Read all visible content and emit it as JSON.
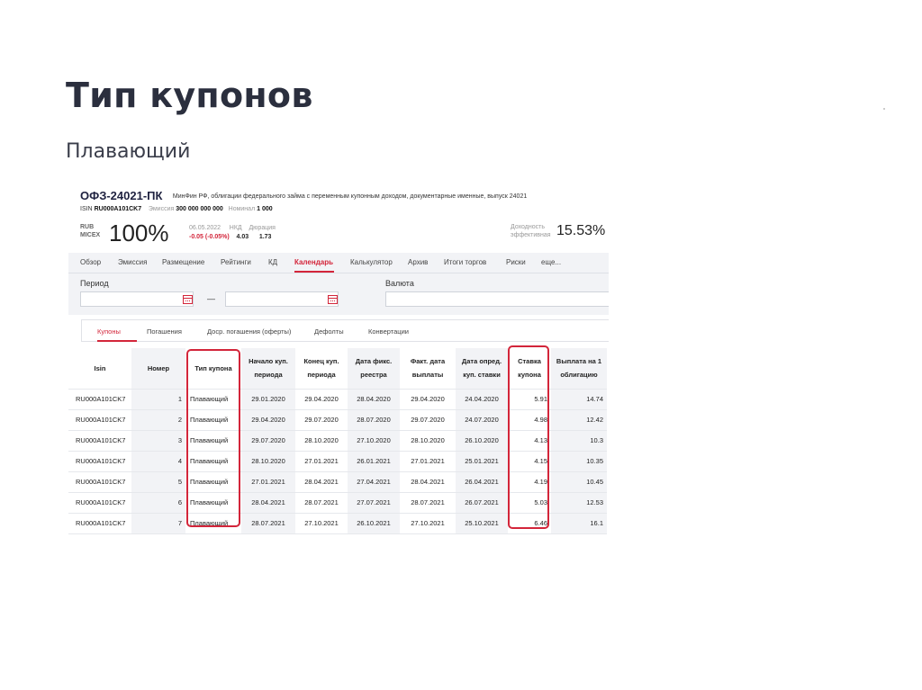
{
  "slide": {
    "title": "Тип купонов",
    "subtitle": "Плавающий"
  },
  "bond": {
    "name": "ОФЗ-24021-ПК",
    "description": "МинФин РФ, облигации федерального займа с переменным купонным доходом, документарные именные, выпуск 24021",
    "isin_label": "ISIN",
    "isin": "RU000A101CK7",
    "emission_label": "Эмиссия",
    "emission": "300 000 000 000",
    "nominal_label": "Номинал",
    "nominal": "1 000"
  },
  "quote": {
    "currency": "RUB",
    "exchange": "MICEX",
    "price": "100%",
    "date": "06.05.2022",
    "change": "-0.05 (-0.05%)",
    "nkd_label": "НКД",
    "nkd": "4.03",
    "duration_label": "Дюрация",
    "duration": "1.73",
    "yield_label_1": "Доходность",
    "yield_label_2": "эффективная",
    "yield": "15.53%"
  },
  "tabs": [
    "Обзор",
    "Эмиссия",
    "Размещение",
    "Рейтинги",
    "КД",
    "Календарь",
    "Калькулятор",
    "Архив",
    "Итоги торгов",
    "Риски",
    "еще..."
  ],
  "active_tab": "Календарь",
  "filters": {
    "period_label": "Период",
    "currency_label": "Валюта",
    "dash": "—"
  },
  "subtabs": [
    "Купоны",
    "Погашения",
    "Доср. погашения (оферты)",
    "Дефолты",
    "Конвертации"
  ],
  "active_subtab": "Купоны",
  "table": {
    "headers": [
      "Isin",
      "Номер",
      "Тип купона",
      "Начало куп. периода",
      "Конец куп. периода",
      "Дата фикс. реестра",
      "Факт. дата выплаты",
      "Дата опред. куп. ставки",
      "Ставка купона",
      "Выплата на 1 облигацию"
    ],
    "rows": [
      [
        "RU000A101CK7",
        "1",
        "Плавающий",
        "29.01.2020",
        "29.04.2020",
        "28.04.2020",
        "29.04.2020",
        "24.04.2020",
        "5.91",
        "14.74"
      ],
      [
        "RU000A101CK7",
        "2",
        "Плавающий",
        "29.04.2020",
        "29.07.2020",
        "28.07.2020",
        "29.07.2020",
        "24.07.2020",
        "4.98",
        "12.42"
      ],
      [
        "RU000A101CK7",
        "3",
        "Плавающий",
        "29.07.2020",
        "28.10.2020",
        "27.10.2020",
        "28.10.2020",
        "26.10.2020",
        "4.13",
        "10.3"
      ],
      [
        "RU000A101CK7",
        "4",
        "Плавающий",
        "28.10.2020",
        "27.01.2021",
        "26.01.2021",
        "27.01.2021",
        "25.01.2021",
        "4.15",
        "10.35"
      ],
      [
        "RU000A101CK7",
        "5",
        "Плавающий",
        "27.01.2021",
        "28.04.2021",
        "27.04.2021",
        "28.04.2021",
        "26.04.2021",
        "4.19",
        "10.45"
      ],
      [
        "RU000A101CK7",
        "6",
        "Плавающий",
        "28.04.2021",
        "28.07.2021",
        "27.07.2021",
        "28.07.2021",
        "26.07.2021",
        "5.03",
        "12.53"
      ],
      [
        "RU000A101CK7",
        "7",
        "Плавающий",
        "28.07.2021",
        "27.10.2021",
        "26.10.2021",
        "27.10.2021",
        "25.10.2021",
        "6.46",
        "16.1"
      ]
    ]
  },
  "colors": {
    "accent": "#d3253a",
    "panel": "#f2f3f6",
    "title": "#2b2f3e"
  }
}
